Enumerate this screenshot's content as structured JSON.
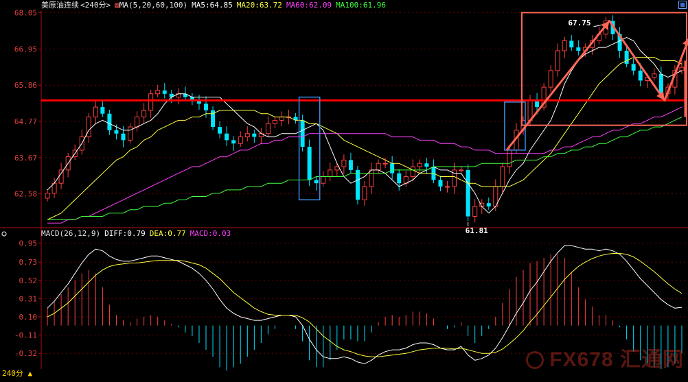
{
  "header": {
    "title": "美原油连续",
    "period": "<240分>",
    "ma_label": "MA(5,20,60,100)",
    "ma5": "MA5:64.85",
    "ma20": "MA20:63.72",
    "ma60": "MA60:62.09",
    "ma100": "MA100:61.96"
  },
  "macd_header": {
    "label": "MACD(26,12,9)",
    "diff": "DIFF:0.79",
    "dea": "DEA:0.77",
    "macd": "MACD:0.03"
  },
  "footer": {
    "period": "240分"
  },
  "watermark": {
    "logo_text": "FX678 汇通网"
  },
  "colors": {
    "background": "#000000",
    "up": "#ff4040",
    "down": "#00e5ff",
    "ma5": "#ffffff",
    "ma20": "#ffff40",
    "ma60": "#ff40ff",
    "ma100": "#40ff40",
    "axis": "#b01010",
    "support": "#ff0000",
    "annotation": "#ff6655",
    "highlight_box": "#3a8ee6"
  },
  "chart_data": [
    {
      "type": "candlestick",
      "price_ticks": [
        "68.05",
        "66.95",
        "65.86",
        "64.77",
        "63.67",
        "62.58"
      ],
      "ylim": [
        61.6,
        68.1
      ],
      "annotations": {
        "high": "67.75",
        "low": "61.81"
      },
      "support_level": 65.4,
      "series": [
        {
          "name": "MA5",
          "values": [
            62.7,
            62.9,
            63.2,
            63.5,
            63.8,
            64.1,
            64.5,
            64.7,
            64.8,
            64.7,
            64.6,
            64.5,
            64.5,
            64.6,
            64.7,
            64.8,
            65.0,
            65.3,
            65.5,
            65.6,
            65.6,
            65.5,
            65.5,
            65.5,
            65.5,
            65.5,
            65.3,
            65.1,
            64.9,
            64.7,
            64.6,
            64.4,
            64.3,
            64.3,
            64.4,
            64.4,
            64.4,
            64.5,
            64.6,
            64.7,
            64.5,
            64.0,
            63.5,
            63.1,
            62.9,
            63.0,
            63.1,
            63.3,
            63.3,
            63.2,
            63.0,
            62.8,
            62.9,
            63.0,
            63.2,
            63.3,
            63.4,
            63.3,
            63.3,
            63.2,
            63.2,
            62.9,
            62.6,
            62.2,
            62.0,
            62.2,
            62.6,
            63.0,
            63.3,
            63.5,
            63.9,
            64.2,
            64.5,
            64.8,
            65.3,
            65.9,
            66.3,
            66.6,
            66.8,
            66.9,
            67.0,
            67.0,
            67.1,
            67.2,
            67.3,
            67.2,
            66.9,
            66.7,
            66.5,
            66.2,
            66.1,
            66.2,
            66.3
          ]
        },
        {
          "name": "MA20",
          "values": [
            61.8,
            61.9,
            62.0,
            62.2,
            62.4,
            62.6,
            62.8,
            63.0,
            63.2,
            63.4,
            63.6,
            63.7,
            63.9,
            64.0,
            64.2,
            64.3,
            64.5,
            64.6,
            64.7,
            64.8,
            64.8,
            64.9,
            64.9,
            65.0,
            65.0,
            65.1,
            65.1,
            65.1,
            65.1,
            65.1,
            65.1,
            65.0,
            65.0,
            64.9,
            64.9,
            64.9,
            64.8,
            64.8,
            64.7,
            64.7,
            64.6,
            64.5,
            64.4,
            64.2,
            64.1,
            64.0,
            63.9,
            63.8,
            63.7,
            63.6,
            63.5,
            63.5,
            63.4,
            63.3,
            63.2,
            63.2,
            63.2,
            63.1,
            63.1,
            63.1,
            63.0,
            62.9,
            62.9,
            62.8,
            62.8,
            62.8,
            62.8,
            62.8,
            62.9,
            63.0,
            63.2,
            63.4,
            63.6,
            63.8,
            64.1,
            64.4,
            64.7,
            65.0,
            65.3,
            65.6,
            65.9,
            66.1,
            66.3,
            66.5,
            66.6,
            66.7,
            66.7,
            66.7,
            66.7,
            66.6,
            66.6,
            66.6,
            66.5
          ]
        },
        {
          "name": "MA60",
          "values": [
            61.7,
            61.7,
            61.7,
            61.8,
            61.8,
            61.9,
            61.9,
            62.0,
            62.1,
            62.2,
            62.3,
            62.4,
            62.5,
            62.6,
            62.7,
            62.8,
            62.9,
            63.0,
            63.1,
            63.2,
            63.3,
            63.4,
            63.4,
            63.5,
            63.6,
            63.7,
            63.7,
            63.8,
            63.9,
            63.9,
            64.0,
            64.1,
            64.1,
            64.2,
            64.2,
            64.3,
            64.3,
            64.3,
            64.4,
            64.4,
            64.4,
            64.4,
            64.4,
            64.4,
            64.4,
            64.4,
            64.4,
            64.4,
            64.4,
            64.4,
            64.3,
            64.3,
            64.3,
            64.3,
            64.2,
            64.2,
            64.2,
            64.1,
            64.1,
            64.1,
            64.0,
            64.0,
            63.9,
            63.9,
            63.9,
            63.8,
            63.8,
            63.8,
            63.8,
            63.8,
            63.8,
            63.8,
            63.8,
            63.9,
            63.9,
            64.0,
            64.0,
            64.1,
            64.2,
            64.3,
            64.3,
            64.4,
            64.5,
            64.5,
            64.6,
            64.7,
            64.7,
            64.8,
            64.9,
            64.9,
            65.0,
            65.1,
            65.2
          ]
        },
        {
          "name": "MA100",
          "values": [
            61.8,
            61.8,
            61.8,
            61.8,
            61.8,
            61.9,
            61.9,
            61.9,
            61.9,
            62.0,
            62.0,
            62.0,
            62.1,
            62.1,
            62.2,
            62.2,
            62.2,
            62.3,
            62.3,
            62.4,
            62.4,
            62.5,
            62.5,
            62.5,
            62.6,
            62.6,
            62.7,
            62.7,
            62.7,
            62.8,
            62.8,
            62.8,
            62.9,
            62.9,
            62.9,
            63.0,
            63.0,
            63.0,
            63.0,
            63.1,
            63.1,
            63.1,
            63.1,
            63.1,
            63.2,
            63.2,
            63.2,
            63.2,
            63.2,
            63.2,
            63.3,
            63.3,
            63.3,
            63.3,
            63.3,
            63.3,
            63.4,
            63.4,
            63.4,
            63.4,
            63.4,
            63.4,
            63.4,
            63.5,
            63.5,
            63.5,
            63.5,
            63.5,
            63.6,
            63.6,
            63.6,
            63.6,
            63.7,
            63.7,
            63.8,
            63.8,
            63.9,
            63.9,
            64.0,
            64.0,
            64.1,
            64.1,
            64.2,
            64.3,
            64.3,
            64.4,
            64.5,
            64.5,
            64.6,
            64.6,
            64.7,
            64.8,
            64.9
          ]
        }
      ],
      "candles_close": [
        62.6,
        62.9,
        63.3,
        63.7,
        63.9,
        64.3,
        64.9,
        65.2,
        65.0,
        64.5,
        64.4,
        64.2,
        64.6,
        64.9,
        65.1,
        65.6,
        65.7,
        65.6,
        65.5,
        65.6,
        65.5,
        65.4,
        65.3,
        65.1,
        64.6,
        64.4,
        64.2,
        64.1,
        64.3,
        64.4,
        64.3,
        64.4,
        64.7,
        64.8,
        64.9,
        64.9,
        64.8,
        64.0,
        63.0,
        62.9,
        63.1,
        63.3,
        63.4,
        63.6,
        63.3,
        62.4,
        62.8,
        63.3,
        63.5,
        63.5,
        63.2,
        62.9,
        63.1,
        63.4,
        63.5,
        63.4,
        63.0,
        62.8,
        62.8,
        63.3,
        63.3,
        61.9,
        62.2,
        62.3,
        62.2,
        62.8,
        63.4,
        63.9,
        64.5,
        64.8,
        65.4,
        65.2,
        65.8,
        66.3,
        66.9,
        67.2,
        67.0,
        66.9,
        67.0,
        67.2,
        67.4,
        67.8,
        67.4,
        66.9,
        66.5,
        66.3,
        66.0,
        66.1,
        66.2,
        65.6,
        65.8,
        66.3,
        66.4
      ]
    },
    {
      "type": "bar",
      "indicator": "MACD(26,12,9)",
      "ticks": [
        "0.95",
        "0.73",
        "0.52",
        "0.31",
        "0.10",
        "-0.11",
        "-0.32"
      ],
      "ylim": [
        -0.5,
        1.0
      ],
      "series": [
        {
          "name": "DIFF",
          "values": [
            0.2,
            0.28,
            0.38,
            0.48,
            0.6,
            0.72,
            0.82,
            0.88,
            0.86,
            0.8,
            0.76,
            0.74,
            0.74,
            0.76,
            0.78,
            0.8,
            0.8,
            0.78,
            0.76,
            0.74,
            0.7,
            0.66,
            0.6,
            0.52,
            0.42,
            0.3,
            0.2,
            0.14,
            0.1,
            0.08,
            0.06,
            0.06,
            0.08,
            0.1,
            0.12,
            0.12,
            0.1,
            0.0,
            -0.16,
            -0.28,
            -0.36,
            -0.38,
            -0.38,
            -0.36,
            -0.38,
            -0.42,
            -0.44,
            -0.4,
            -0.34,
            -0.3,
            -0.28,
            -0.28,
            -0.26,
            -0.22,
            -0.2,
            -0.2,
            -0.22,
            -0.26,
            -0.28,
            -0.28,
            -0.24,
            -0.34,
            -0.4,
            -0.38,
            -0.34,
            -0.26,
            -0.14,
            0.0,
            0.14,
            0.26,
            0.4,
            0.5,
            0.62,
            0.74,
            0.84,
            0.92,
            0.92,
            0.9,
            0.88,
            0.88,
            0.86,
            0.88,
            0.86,
            0.82,
            0.74,
            0.64,
            0.54,
            0.46,
            0.38,
            0.3,
            0.24,
            0.2,
            0.21
          ]
        },
        {
          "name": "DEA",
          "values": [
            0.1,
            0.14,
            0.2,
            0.26,
            0.34,
            0.42,
            0.5,
            0.58,
            0.64,
            0.68,
            0.7,
            0.71,
            0.72,
            0.72,
            0.73,
            0.74,
            0.75,
            0.75,
            0.75,
            0.75,
            0.74,
            0.72,
            0.7,
            0.66,
            0.6,
            0.54,
            0.46,
            0.38,
            0.32,
            0.26,
            0.2,
            0.16,
            0.13,
            0.12,
            0.12,
            0.12,
            0.12,
            0.09,
            0.04,
            -0.04,
            -0.12,
            -0.18,
            -0.24,
            -0.28,
            -0.3,
            -0.33,
            -0.35,
            -0.36,
            -0.36,
            -0.35,
            -0.34,
            -0.33,
            -0.32,
            -0.3,
            -0.28,
            -0.27,
            -0.26,
            -0.26,
            -0.26,
            -0.27,
            -0.26,
            -0.28,
            -0.3,
            -0.32,
            -0.32,
            -0.31,
            -0.27,
            -0.21,
            -0.14,
            -0.06,
            0.04,
            0.13,
            0.23,
            0.33,
            0.43,
            0.53,
            0.61,
            0.68,
            0.73,
            0.77,
            0.8,
            0.82,
            0.83,
            0.83,
            0.82,
            0.79,
            0.74,
            0.68,
            0.62,
            0.55,
            0.48,
            0.42,
            0.37
          ]
        }
      ]
    }
  ]
}
